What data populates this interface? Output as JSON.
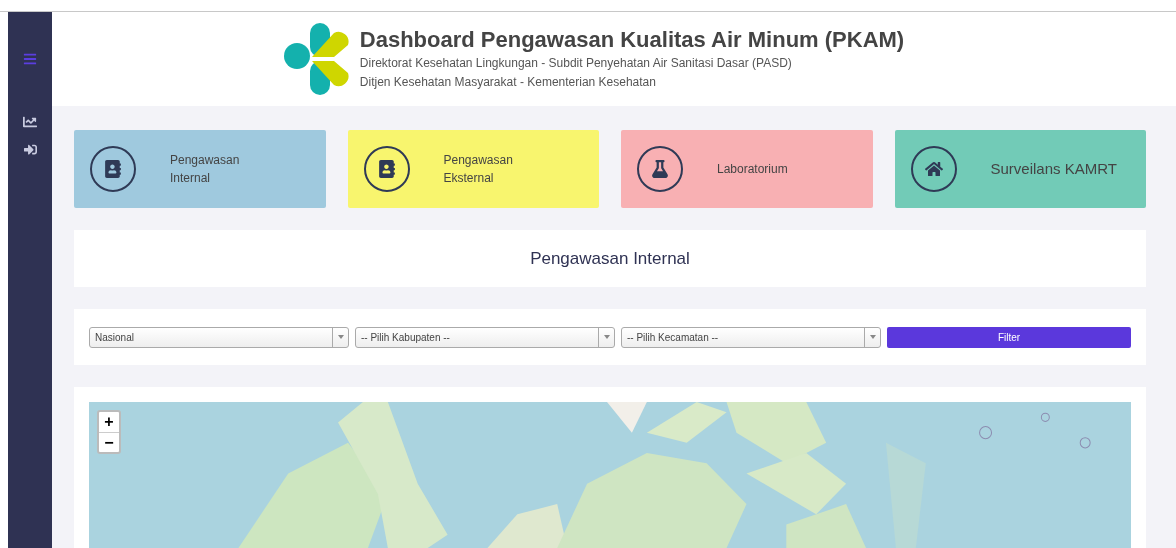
{
  "header": {
    "title": "Dashboard Pengawasan Kualitas Air Minum (PKAM)",
    "subtitle_lines": [
      "Direktorat Kesehatan Lingkungan - Subdit Penyehatan Air Sanitasi Dasar (PASD)",
      "Ditjen Kesehatan Masyarakat - Kementerian Kesehatan"
    ]
  },
  "sidebar": {
    "items": [
      {
        "kind": "chart"
      },
      {
        "kind": "login"
      }
    ]
  },
  "cards": [
    {
      "label": "Pengawasan\nInternal",
      "kind": "contact",
      "color": "#9fc9de"
    },
    {
      "label": "Pengawasan\nEksternal",
      "kind": "contact",
      "color": "#f8f56e"
    },
    {
      "label": "Laboratorium",
      "kind": "flask",
      "color": "#f8b0b3"
    },
    {
      "label": "Surveilans KAMRT",
      "kind": "home",
      "color": "#72cbb7"
    }
  ],
  "section_title": "Pengawasan Internal",
  "filters": {
    "selects": [
      {
        "value": "Nasional"
      },
      {
        "value": "-- Pilih Kabupaten --"
      },
      {
        "value": "-- Pilih Kecamatan --"
      }
    ],
    "button": "Filter"
  },
  "map": {
    "kind": "picture",
    "zoom_buttons": [
      "+",
      "−"
    ]
  }
}
